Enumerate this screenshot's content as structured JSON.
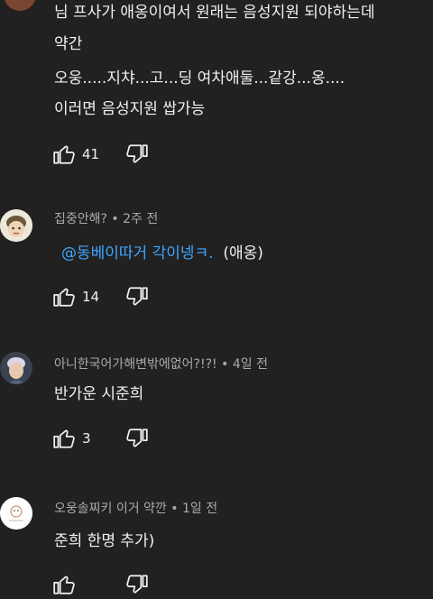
{
  "comments": [
    {
      "author": "",
      "time": "",
      "lines": [
        "님 프사가 애옹이여서 원래는 음성지원 되야하는데",
        "약간",
        "오웅.....지챠...고...딩 여차애둘...같강...옹....",
        "이러면 음성지원 쌉가능"
      ],
      "likes": "41"
    },
    {
      "author": "집중안해?",
      "time": "2주 전",
      "mention": "@동베이따거 각이넹ㅋ.",
      "reply_text": "(애옹)",
      "likes": "14"
    },
    {
      "author": "아니한국어가해변밖에없어?!?!",
      "time": "4일 전",
      "lines": [
        "반가운 시준희"
      ],
      "likes": "3"
    },
    {
      "author": "오웅솔찌키 이거 약깐",
      "time": "1일 전",
      "lines": [
        "준희 한명 추가)"
      ],
      "likes": ""
    }
  ],
  "meta_separator": " • ",
  "colors": {
    "background": "#212121",
    "text_primary": "#f1f1f1",
    "text_secondary": "#aaaaaa",
    "mention": "#3ea6ff"
  },
  "icons": {
    "like": "thumb-up-outline-icon",
    "dislike": "thumb-down-outline-icon"
  }
}
